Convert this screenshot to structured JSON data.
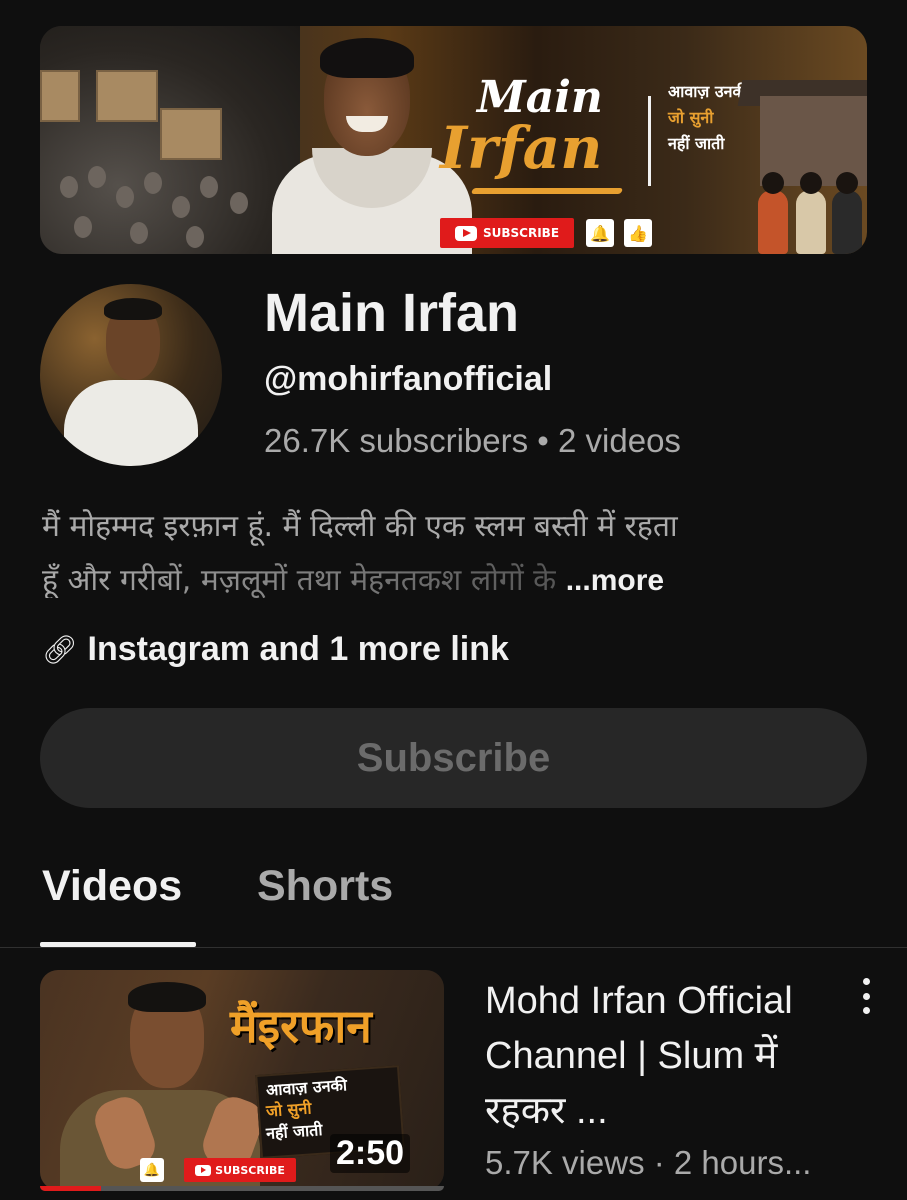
{
  "banner": {
    "title_line1": "Main",
    "title_line2": "Irfan",
    "tagline": [
      "आवाज़ उनकी",
      "जो सुनी",
      "नहीं जाती"
    ],
    "subscribe_label": "SUBSCRIBE"
  },
  "channel": {
    "name": "Main Irfan",
    "handle": "@mohirfanofficial",
    "stats": "26.7K subscribers • 2 videos",
    "description_line1": "मैं मोहम्मद इरफ़ान हूं. मैं दिल्ली की एक स्लम बस्ती में रहता",
    "description_line2": "हूँ और गरीबों, मज़लूमों तथा मेहनतकश लोगों के",
    "more_label": "...more",
    "links_label": "Instagram and 1 more link",
    "subscribe_button": "Subscribe"
  },
  "tabs": [
    {
      "label": "Videos",
      "active": true
    },
    {
      "label": "Shorts",
      "active": false
    }
  ],
  "videos": [
    {
      "thumbnail_title": "मैंइरफान",
      "thumbnail_tagline": [
        "आवाज़ उनकी",
        "जो सुनी",
        "नहीं जाती"
      ],
      "thumbnail_subscribe": "SUBSCRIBE",
      "duration": "2:50",
      "watch_progress": 0.15,
      "title": "Mohd Irfan Official Channel | Slum में रहकर ...",
      "meta": "5.7K views · 2 hours..."
    }
  ],
  "colors": {
    "background": "#0f0f0f",
    "accent_red": "#e01b1b",
    "banner_orange": "#e8a030",
    "secondary_text": "#aaaaaa"
  }
}
